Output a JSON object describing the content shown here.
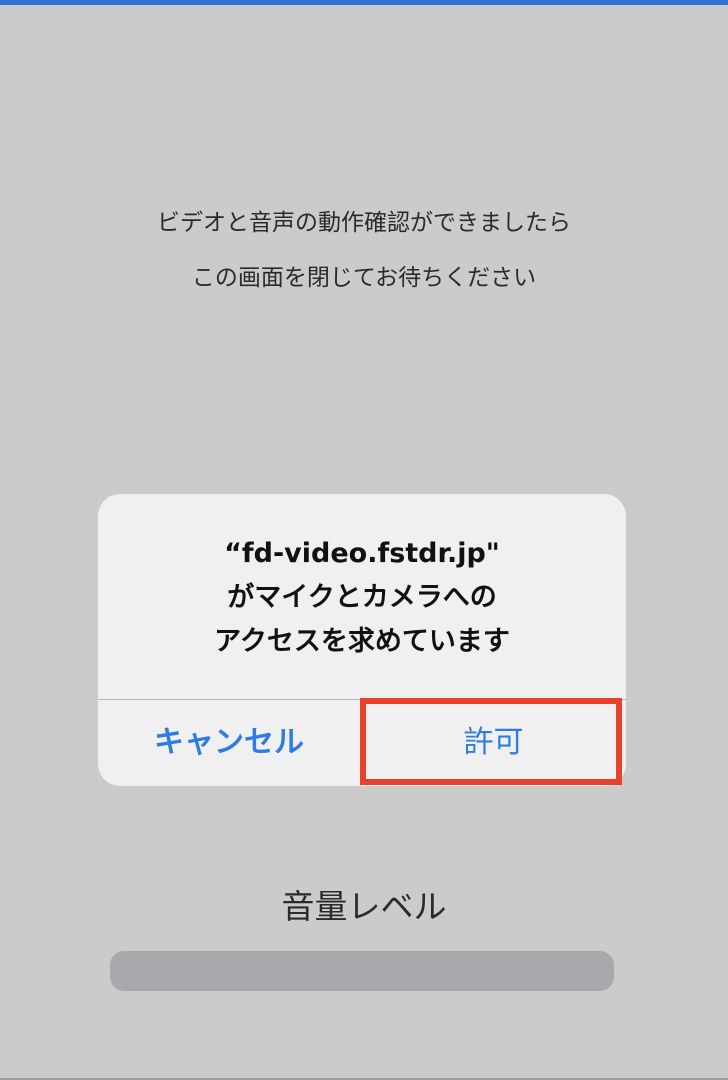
{
  "colors": {
    "accent": "#2d7be5",
    "highlight": "#e8412c",
    "background": "#cbcbcb",
    "dialog_background": "#f0f0f0",
    "top_bar": "#2f6fd6"
  },
  "instructions": {
    "line1": "ビデオと音声の動作確認ができましたら",
    "line2": "この画面を閉じてお待ちください"
  },
  "dialog": {
    "message_line1": "“fd-video.fstdr.jp\"",
    "message_line2": "がマイクとカメラへの",
    "message_line3": "アクセスを求めています",
    "cancel_label": "キャンセル",
    "allow_label": "許可"
  },
  "volume": {
    "label": "音量レベル",
    "level": 0
  }
}
